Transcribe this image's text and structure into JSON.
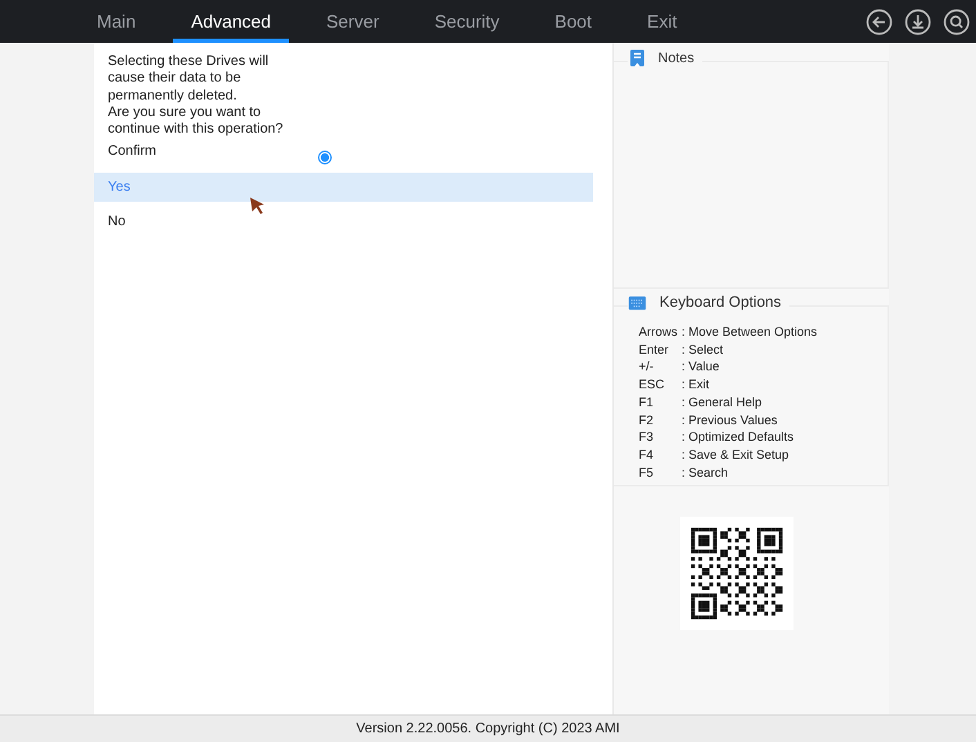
{
  "tabs": [
    {
      "label": "Main",
      "selected": false
    },
    {
      "label": "Advanced",
      "selected": true
    },
    {
      "label": "Server",
      "selected": false
    },
    {
      "label": "Security",
      "selected": false
    },
    {
      "label": "Boot",
      "selected": false
    },
    {
      "label": "Exit",
      "selected": false
    }
  ],
  "prompt": [
    "Selecting these Drives will",
    "cause their data to be",
    "permanently deleted.",
    "Are you sure you want to",
    "continue with this operation?"
  ],
  "confirm": {
    "label": "Confirm",
    "checked": true
  },
  "options": [
    {
      "label": "Yes",
      "selected": true
    },
    {
      "label": "No",
      "selected": false
    }
  ],
  "notes": {
    "title": "Notes"
  },
  "keyboard": {
    "title": "Keyboard Options",
    "items": [
      {
        "key": "Arrows",
        "desc": ": Move Between Options"
      },
      {
        "key": "Enter",
        "desc": ": Select"
      },
      {
        "key": "+/-",
        "desc": ": Value"
      },
      {
        "key": "ESC",
        "desc": ": Exit"
      },
      {
        "key": "F1",
        "desc": ": General Help"
      },
      {
        "key": "F2",
        "desc": ": Previous Values"
      },
      {
        "key": "F3",
        "desc": ": Optimized Defaults"
      },
      {
        "key": "F4",
        "desc": ": Save & Exit Setup"
      },
      {
        "key": "F5",
        "desc": ": Search"
      }
    ]
  },
  "footer": "Version 2.22.0056. Copyright (C) 2023 AMI"
}
